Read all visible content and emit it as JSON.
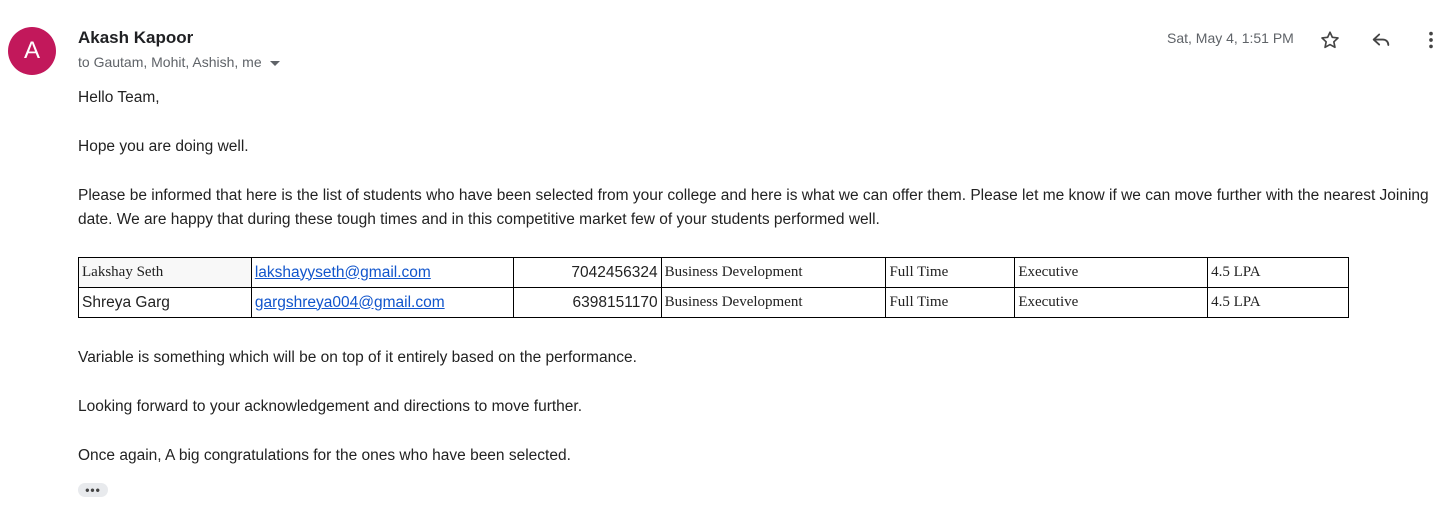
{
  "email": {
    "avatar_letter": "A",
    "avatar_color": "#c2185b",
    "sender": "Akash Kapoor",
    "recipients": "to Gautam, Mohit, Ashish, me",
    "date": "Sat, May 4, 1:51 PM",
    "icons": {
      "star": "star-icon",
      "reply": "reply-icon",
      "more": "more-vert-icon",
      "caret": "caret-down-icon"
    },
    "greeting": "Hello Team,",
    "line1": "Hope you are doing well.",
    "paragraph": "Please be informed that here is the list of students who have been selected from your college and here is what we can offer them. Please let me know if we can move further with the nearest Joining date. We are happy that during these tough times and in this competitive market few of your students performed well.",
    "table": {
      "rows": [
        {
          "name": "Lakshay Seth",
          "email": "lakshayyseth@gmail.com",
          "phone": "7042456324",
          "department": "Business Development",
          "type": "Full Time",
          "role": "Executive",
          "ctc": "4.5 LPA"
        },
        {
          "name": "Shreya Garg",
          "email": "gargshreya004@gmail.com",
          "phone": "6398151170",
          "department": "Business Development",
          "type": "Full Time",
          "role": "Executive",
          "ctc": "4.5 LPA"
        }
      ]
    },
    "line_variable": "Variable is something which will be on top of it entirely based on the performance.",
    "line_forward": "Looking forward to your acknowledgement and directions to move further.",
    "line_congrats": "Once again, A big congratulations for the ones who have been selected.",
    "ellipsis": "•••"
  }
}
